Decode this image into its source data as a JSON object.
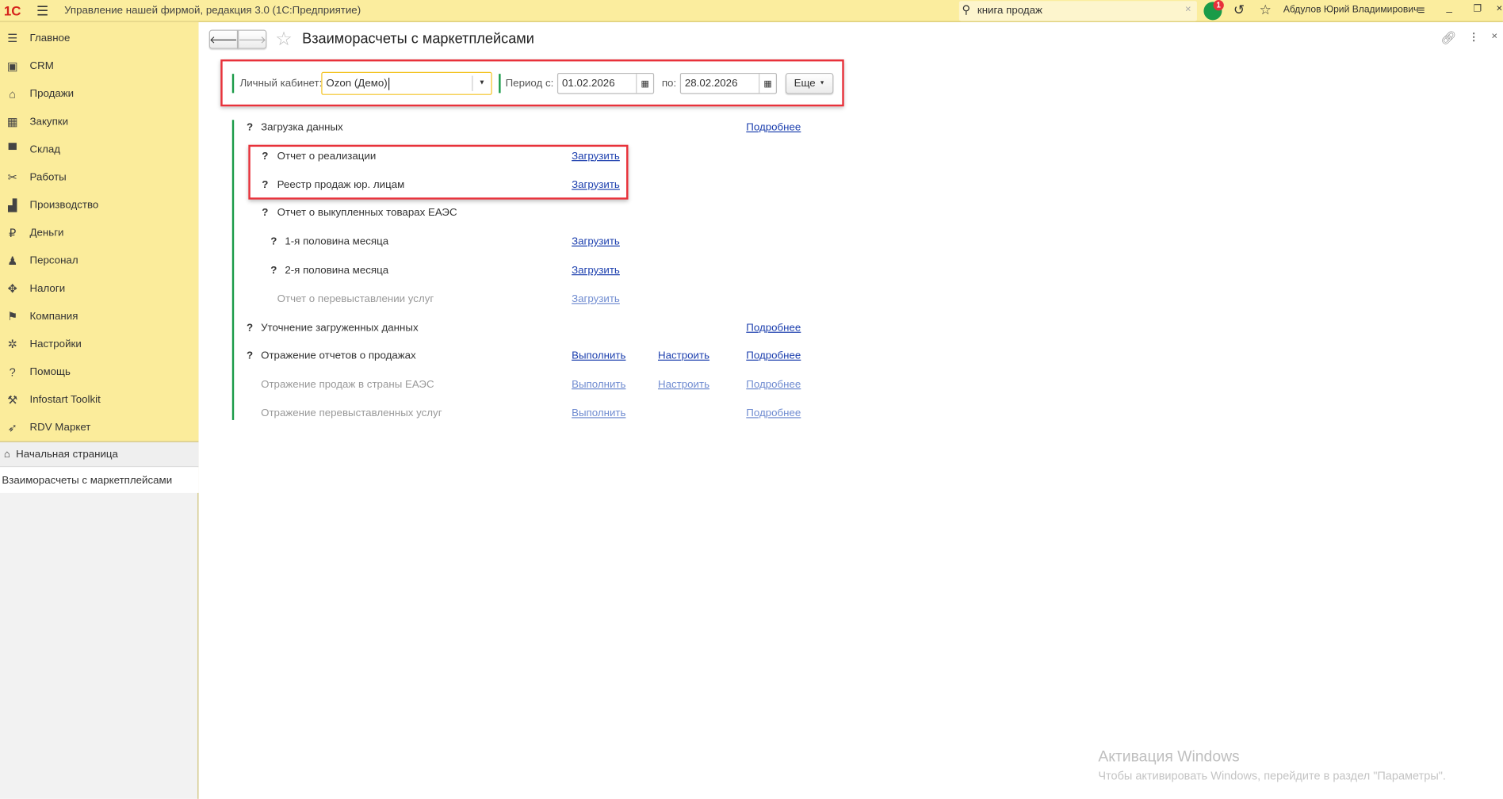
{
  "app": {
    "title": "Управление нашей фирмой, редакция 3.0  (1С:Предприятие)",
    "search_value": "книга продаж",
    "notification_count": "1",
    "user": "Абдулов Юрий Владимирович"
  },
  "sidebar": {
    "items": [
      {
        "label": "Главное",
        "icon": "menu-icon"
      },
      {
        "label": "CRM",
        "icon": "crm-icon"
      },
      {
        "label": "Продажи",
        "icon": "basket-icon"
      },
      {
        "label": "Закупки",
        "icon": "cart-icon"
      },
      {
        "label": "Склад",
        "icon": "warehouse-icon"
      },
      {
        "label": "Работы",
        "icon": "tools-icon"
      },
      {
        "label": "Производство",
        "icon": "factory-icon"
      },
      {
        "label": "Деньги",
        "icon": "ruble-icon"
      },
      {
        "label": "Персонал",
        "icon": "people-icon"
      },
      {
        "label": "Налоги",
        "icon": "eagle-icon"
      },
      {
        "label": "Компания",
        "icon": "flag-icon"
      },
      {
        "label": "Настройки",
        "icon": "gear-icon"
      },
      {
        "label": "Помощь",
        "icon": "help-icon"
      },
      {
        "label": "Infostart Toolkit",
        "icon": "wrench-icon"
      },
      {
        "label": "RDV Маркет",
        "icon": "rocket-icon"
      }
    ],
    "home": "Начальная страница",
    "open_window": "Взаиморасчеты с маркетплейсами"
  },
  "page": {
    "title": "Взаиморасчеты с маркетплейсами"
  },
  "filters": {
    "account_label": "Личный кабинет:",
    "account_value": "Ozon (Демо)",
    "period_from_label": "Период с:",
    "period_from": "01.02.2026",
    "period_to_label": "по:",
    "period_to": "28.02.2026",
    "more_label": "Еще"
  },
  "rows": [
    {
      "q": "?",
      "text": "Загрузка данных",
      "more": "Подробнее"
    },
    {
      "q": "?",
      "text": "Отчет о реализации",
      "load": "Загрузить"
    },
    {
      "q": "?",
      "text": "Реестр продаж юр. лицам",
      "load": "Загрузить"
    },
    {
      "q": "?",
      "text": "Отчет о выкупленных товарах ЕАЭС"
    },
    {
      "q": "?",
      "text": "1-я половина месяца",
      "load": "Загрузить"
    },
    {
      "q": "?",
      "text": "2-я половина месяца",
      "load": "Загрузить"
    },
    {
      "text": "Отчет о перевыставлении услуг",
      "load": "Загрузить"
    },
    {
      "q": "?",
      "text": "Уточнение загруженных данных",
      "more": "Подробнее"
    },
    {
      "q": "?",
      "text": "Отражение отчетов о продажах",
      "run": "Выполнить",
      "setup": "Настроить",
      "more": "Подробнее"
    },
    {
      "text": "Отражение продаж в страны ЕАЭС",
      "run": "Выполнить",
      "setup": "Настроить",
      "more": "Подробнее"
    },
    {
      "text": "Отражение перевыставленных услуг",
      "run": "Выполнить",
      "more": "Подробнее"
    }
  ],
  "watermark": {
    "title": "Активация Windows",
    "subtitle": "Чтобы активировать Windows, перейдите в раздел \"Параметры\"."
  },
  "colors": {
    "sidebar": "#fbec9b",
    "link": "#1c3fae",
    "highlight": "#e8313a",
    "green": "#1a9b48"
  }
}
